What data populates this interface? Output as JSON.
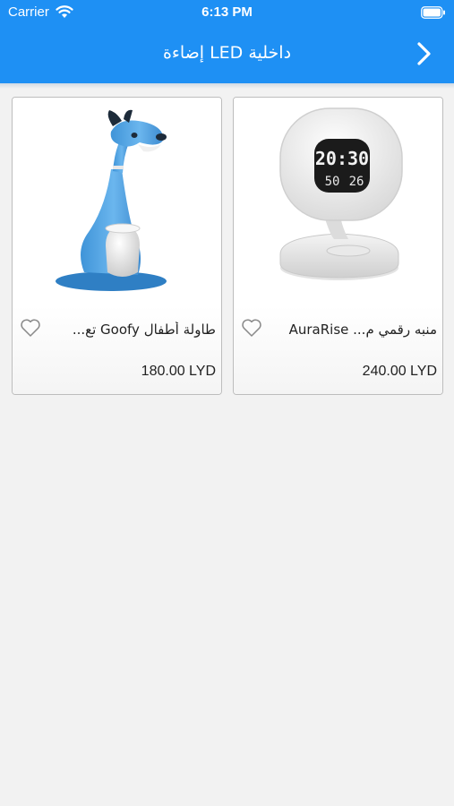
{
  "status_bar": {
    "carrier": "Carrier",
    "time": "6:13 PM"
  },
  "nav": {
    "title": "إضاءة LED داخلية"
  },
  "products": [
    {
      "name": "منبه رقمي م... AuraRise",
      "price": "240.00 LYD",
      "clock_display": {
        "time": "20:30",
        "humidity": "50",
        "temp": "26"
      }
    },
    {
      "name": "طاولة أطفال Goofy تع...",
      "price": "180.00 LYD"
    }
  ],
  "colors": {
    "accent": "#1e90f4",
    "background": "#f2f2f2"
  },
  "icons": {
    "back": "chevron-right-icon",
    "favorite": "heart-outline-icon",
    "wifi": "wifi-icon",
    "battery": "battery-icon"
  }
}
